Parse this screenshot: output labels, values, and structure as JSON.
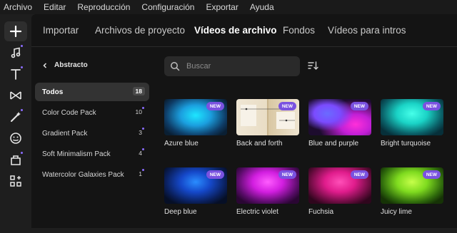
{
  "menu": [
    "Archivo",
    "Editar",
    "Reproducción",
    "Configuración",
    "Exportar",
    "Ayuda"
  ],
  "rail_icons": [
    "plus-icon",
    "music-icon",
    "text-icon",
    "transitions-icon",
    "effects-icon",
    "sticker-icon",
    "plugins-icon",
    "apps-icon"
  ],
  "tabs": [
    "Importar",
    "Archivos de proyecto",
    "Vídeos de archivo",
    "Fondos",
    "Vídeos para intros"
  ],
  "active_tab": "Vídeos de archivo",
  "category_header": "Abstracto",
  "categories": [
    {
      "label": "Todos",
      "count": "18"
    },
    {
      "label": "Color Code Pack",
      "count": "10"
    },
    {
      "label": "Gradient Pack",
      "count": "3"
    },
    {
      "label": "Soft Minimalism Pack",
      "count": "4"
    },
    {
      "label": "Watercolor Galaxies Pack",
      "count": "1"
    }
  ],
  "search": {
    "placeholder": "Buscar"
  },
  "badge": "NEW",
  "videos": [
    {
      "label": "Azure blue"
    },
    {
      "label": "Back and forth"
    },
    {
      "label": "Blue and purple"
    },
    {
      "label": "Bright turquoise"
    },
    {
      "label": "Deep blue"
    },
    {
      "label": "Electric violet"
    },
    {
      "label": "Fuchsia"
    },
    {
      "label": "Juicy lime"
    }
  ],
  "colors": {
    "accent": "#7a52e0",
    "background": "#141414",
    "rail": "#1e1e1e"
  }
}
